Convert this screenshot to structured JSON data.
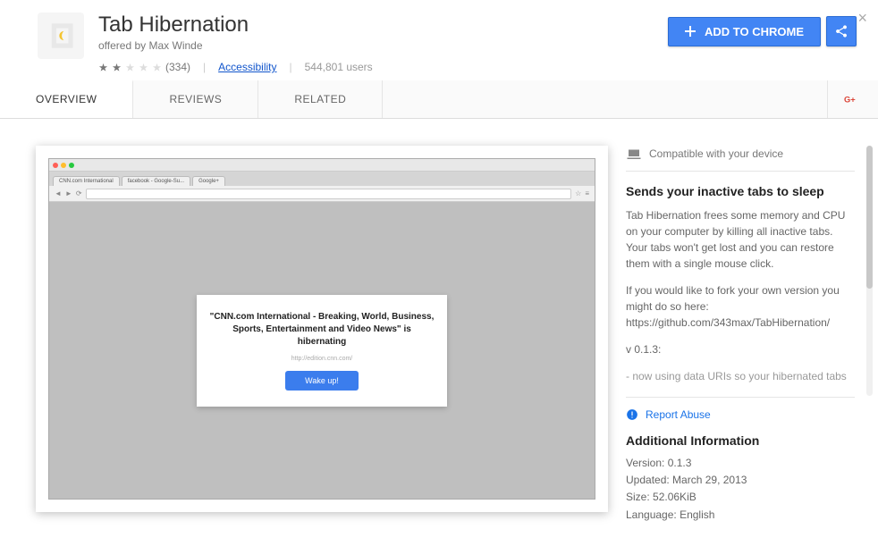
{
  "header": {
    "title": "Tab Hibernation",
    "offered_by": "offered by Max Winde",
    "rating_count": "(334)",
    "accessibility": "Accessibility",
    "users": "544,801 users",
    "add_button": "ADD TO CHROME"
  },
  "tabs": {
    "overview": "OVERVIEW",
    "reviews": "REVIEWS",
    "related": "RELATED"
  },
  "screenshot": {
    "tab1": "CNN.com International",
    "tab2": "facebook - Google-Su...",
    "tab3": "Google+",
    "card_title": "\"CNN.com International - Breaking, World, Business, Sports, Entertainment and Video News\" is hibernating",
    "card_url": "http://edition.cnn.com/",
    "wake_button": "Wake up!"
  },
  "sidebar": {
    "compatible": "Compatible with your device",
    "title": "Sends your inactive tabs to sleep",
    "desc1": "Tab Hibernation frees some memory and CPU on your computer by killing all inactive tabs. Your tabs won't get lost and you can restore them with a single mouse click.",
    "desc2": "If you would like to fork your own version you might do so here: https://github.com/343max/TabHibernation/",
    "desc3": "v 0.1.3:",
    "desc4": "- now using data URIs so your hibernated tabs won't get closed when uninstalling/updating the extension (sorry",
    "report": "Report Abuse",
    "info_title": "Additional Information",
    "version_label": "Version:",
    "version_value": "0.1.3",
    "updated_label": "Updated:",
    "updated_value": "March 29, 2013",
    "size_label": "Size:",
    "size_value": "52.06KiB",
    "language_label": "Language:",
    "language_value": "English"
  }
}
